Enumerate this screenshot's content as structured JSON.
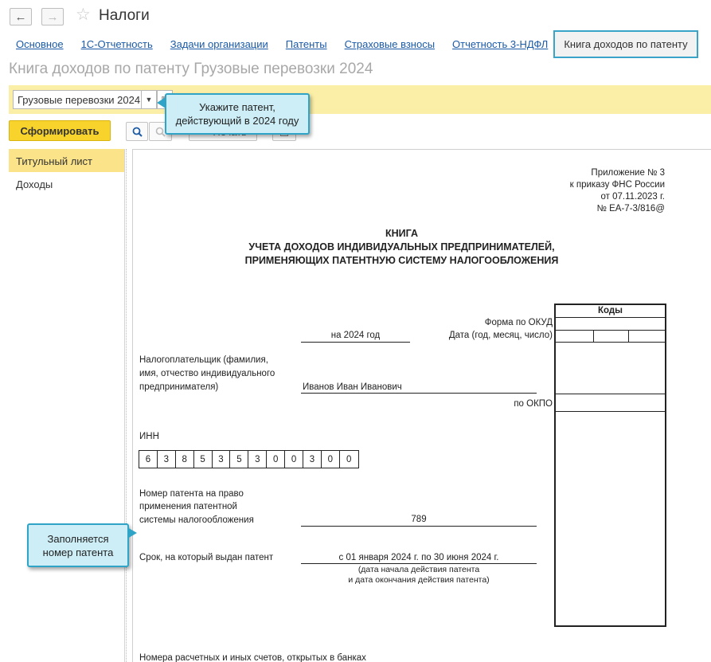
{
  "window": {
    "title": "Налоги",
    "back_icon": "←",
    "forward_icon": "→",
    "favorite_icon": "☆"
  },
  "tabs": [
    {
      "label": "Основное"
    },
    {
      "label": "1С-Отчетность"
    },
    {
      "label": "Задачи организации"
    },
    {
      "label": "Патенты"
    },
    {
      "label": "Страховые взносы"
    },
    {
      "label": "Отчетность 3-НДФЛ"
    },
    {
      "label": "Книга доходов по патенту",
      "active": true
    }
  ],
  "page_title": "Книга доходов по патенту Грузовые перевозки 2024",
  "filter": {
    "patent_value": "Грузовые перевозки 2024"
  },
  "toolbar": {
    "generate_label": "Сформировать",
    "print_label": "Печать"
  },
  "callouts": {
    "patent_hint": "Укажите патент, действующий в 2024 году",
    "number_hint": "Заполняется номер патента"
  },
  "left_panel": {
    "items": [
      {
        "label": "Титульный лист",
        "selected": true
      },
      {
        "label": "Доходы"
      }
    ]
  },
  "document": {
    "appendix": [
      "Приложение № 3",
      "к приказу ФНС России",
      "от 07.11.2023 г.",
      "№ ЕА-7-3/816@"
    ],
    "title": [
      "КНИГА",
      "УЧЕТА ДОХОДОВ ИНДИВИДУАЛЬНЫХ ПРЕДПРИНИМАТЕЛЕЙ,",
      "ПРИМЕНЯЮЩИХ ПАТЕНТНУЮ СИСТЕМУ НАЛОГООБЛОЖЕНИЯ"
    ],
    "codes_header": "Коды",
    "form_okud_label": "Форма по ОКУД",
    "date_label": "Дата (год, месяц, число)",
    "year_text": "на 2024 год",
    "taxpayer_label": [
      "Налогоплательщик (фамилия,",
      "имя, отчество индивидуального",
      "предпринимателя)"
    ],
    "taxpayer_value": "Иванов Иван Иванович",
    "okpo_label": "по ОКПО",
    "inn_label": "ИНН",
    "inn_digits": [
      "6",
      "3",
      "8",
      "5",
      "3",
      "5",
      "3",
      "0",
      "0",
      "3",
      "0",
      "0"
    ],
    "patent_number_label": [
      "Номер патента на право",
      "применения патентной",
      "системы налогообложения"
    ],
    "patent_number_value": "789",
    "period_label": "Срок, на который выдан патент",
    "period_value": "с 01 января 2024 г. по 30 июня 2024 г.",
    "period_note": [
      "(дата начала действия патента",
      "и дата окончания действия патента)"
    ],
    "accounts_label": "Номера расчетных и иных счетов, открытых в банках"
  }
}
